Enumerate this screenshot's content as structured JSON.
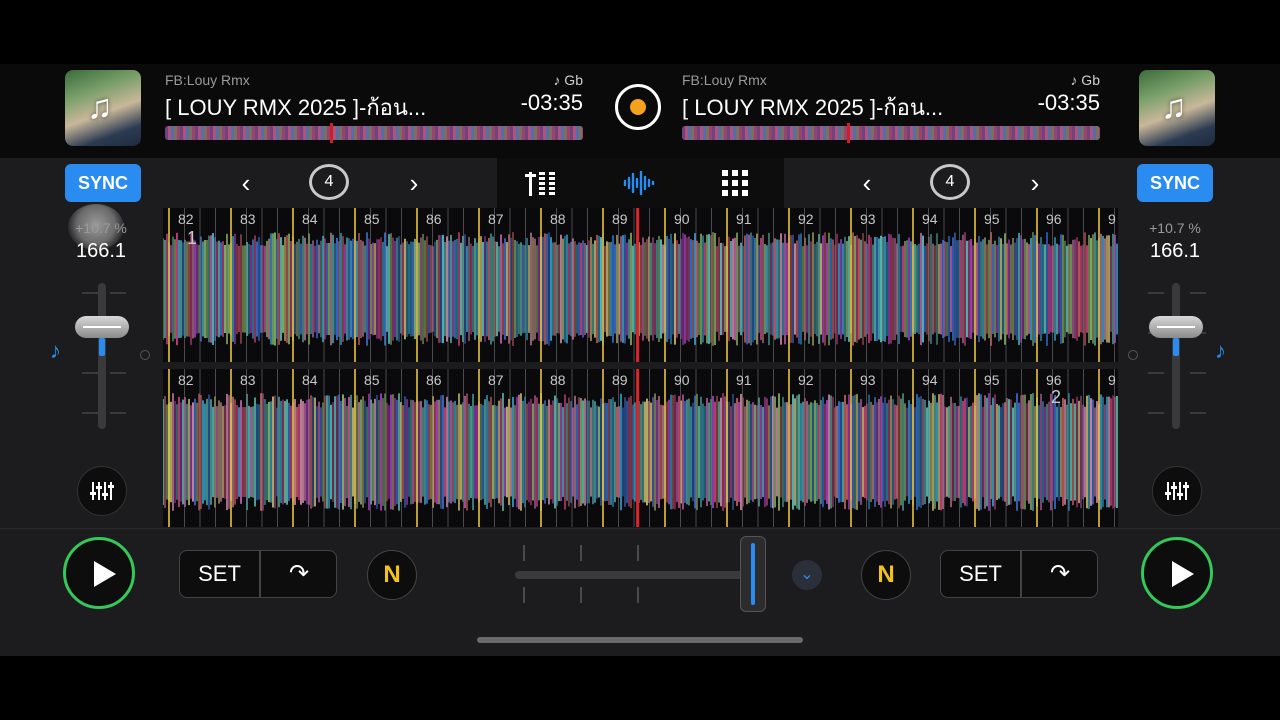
{
  "deck_left": {
    "artist": "FB:Louy Rmx",
    "title": "[ LOUY RMX      2025    ]-ก้อน...",
    "key": "♪ Gb",
    "remaining": "-03:35",
    "sync_label": "SYNC",
    "pitch": "+10.7 %",
    "bpm": "166.1",
    "deck_number": "1",
    "playhead_fraction": 0.4
  },
  "deck_right": {
    "artist": "FB:Louy Rmx",
    "title": "[ LOUY RMX      2025    ]-ก้อน...",
    "key": "♪ Gb",
    "remaining": "-03:35",
    "sync_label": "SYNC",
    "pitch": "+10.7 %",
    "bpm": "166.1",
    "deck_number": "2",
    "playhead_fraction": 0.4
  },
  "toolbar": {
    "loop_left": "4",
    "loop_right": "4",
    "prev": "‹",
    "next": "›"
  },
  "beat_numbers": [
    "82",
    "83",
    "84",
    "85",
    "86",
    "87",
    "88",
    "89",
    "90",
    "91",
    "92",
    "93",
    "94",
    "95",
    "96",
    "9"
  ],
  "bottom": {
    "set_label": "SET",
    "n_label": "N"
  },
  "colors": {
    "accent": "#2a8cf0",
    "play_ring": "#34c759",
    "playhead": "#e0232b",
    "beat_marker": "#f4d03f",
    "center_dot": "#f4a21d"
  },
  "icons": {
    "mixer": "mixer-icon",
    "waveform": "waveform-view-icon",
    "grid": "pads-grid-icon",
    "eq": "eq-sliders-icon",
    "jump": "cue-jump-icon"
  }
}
